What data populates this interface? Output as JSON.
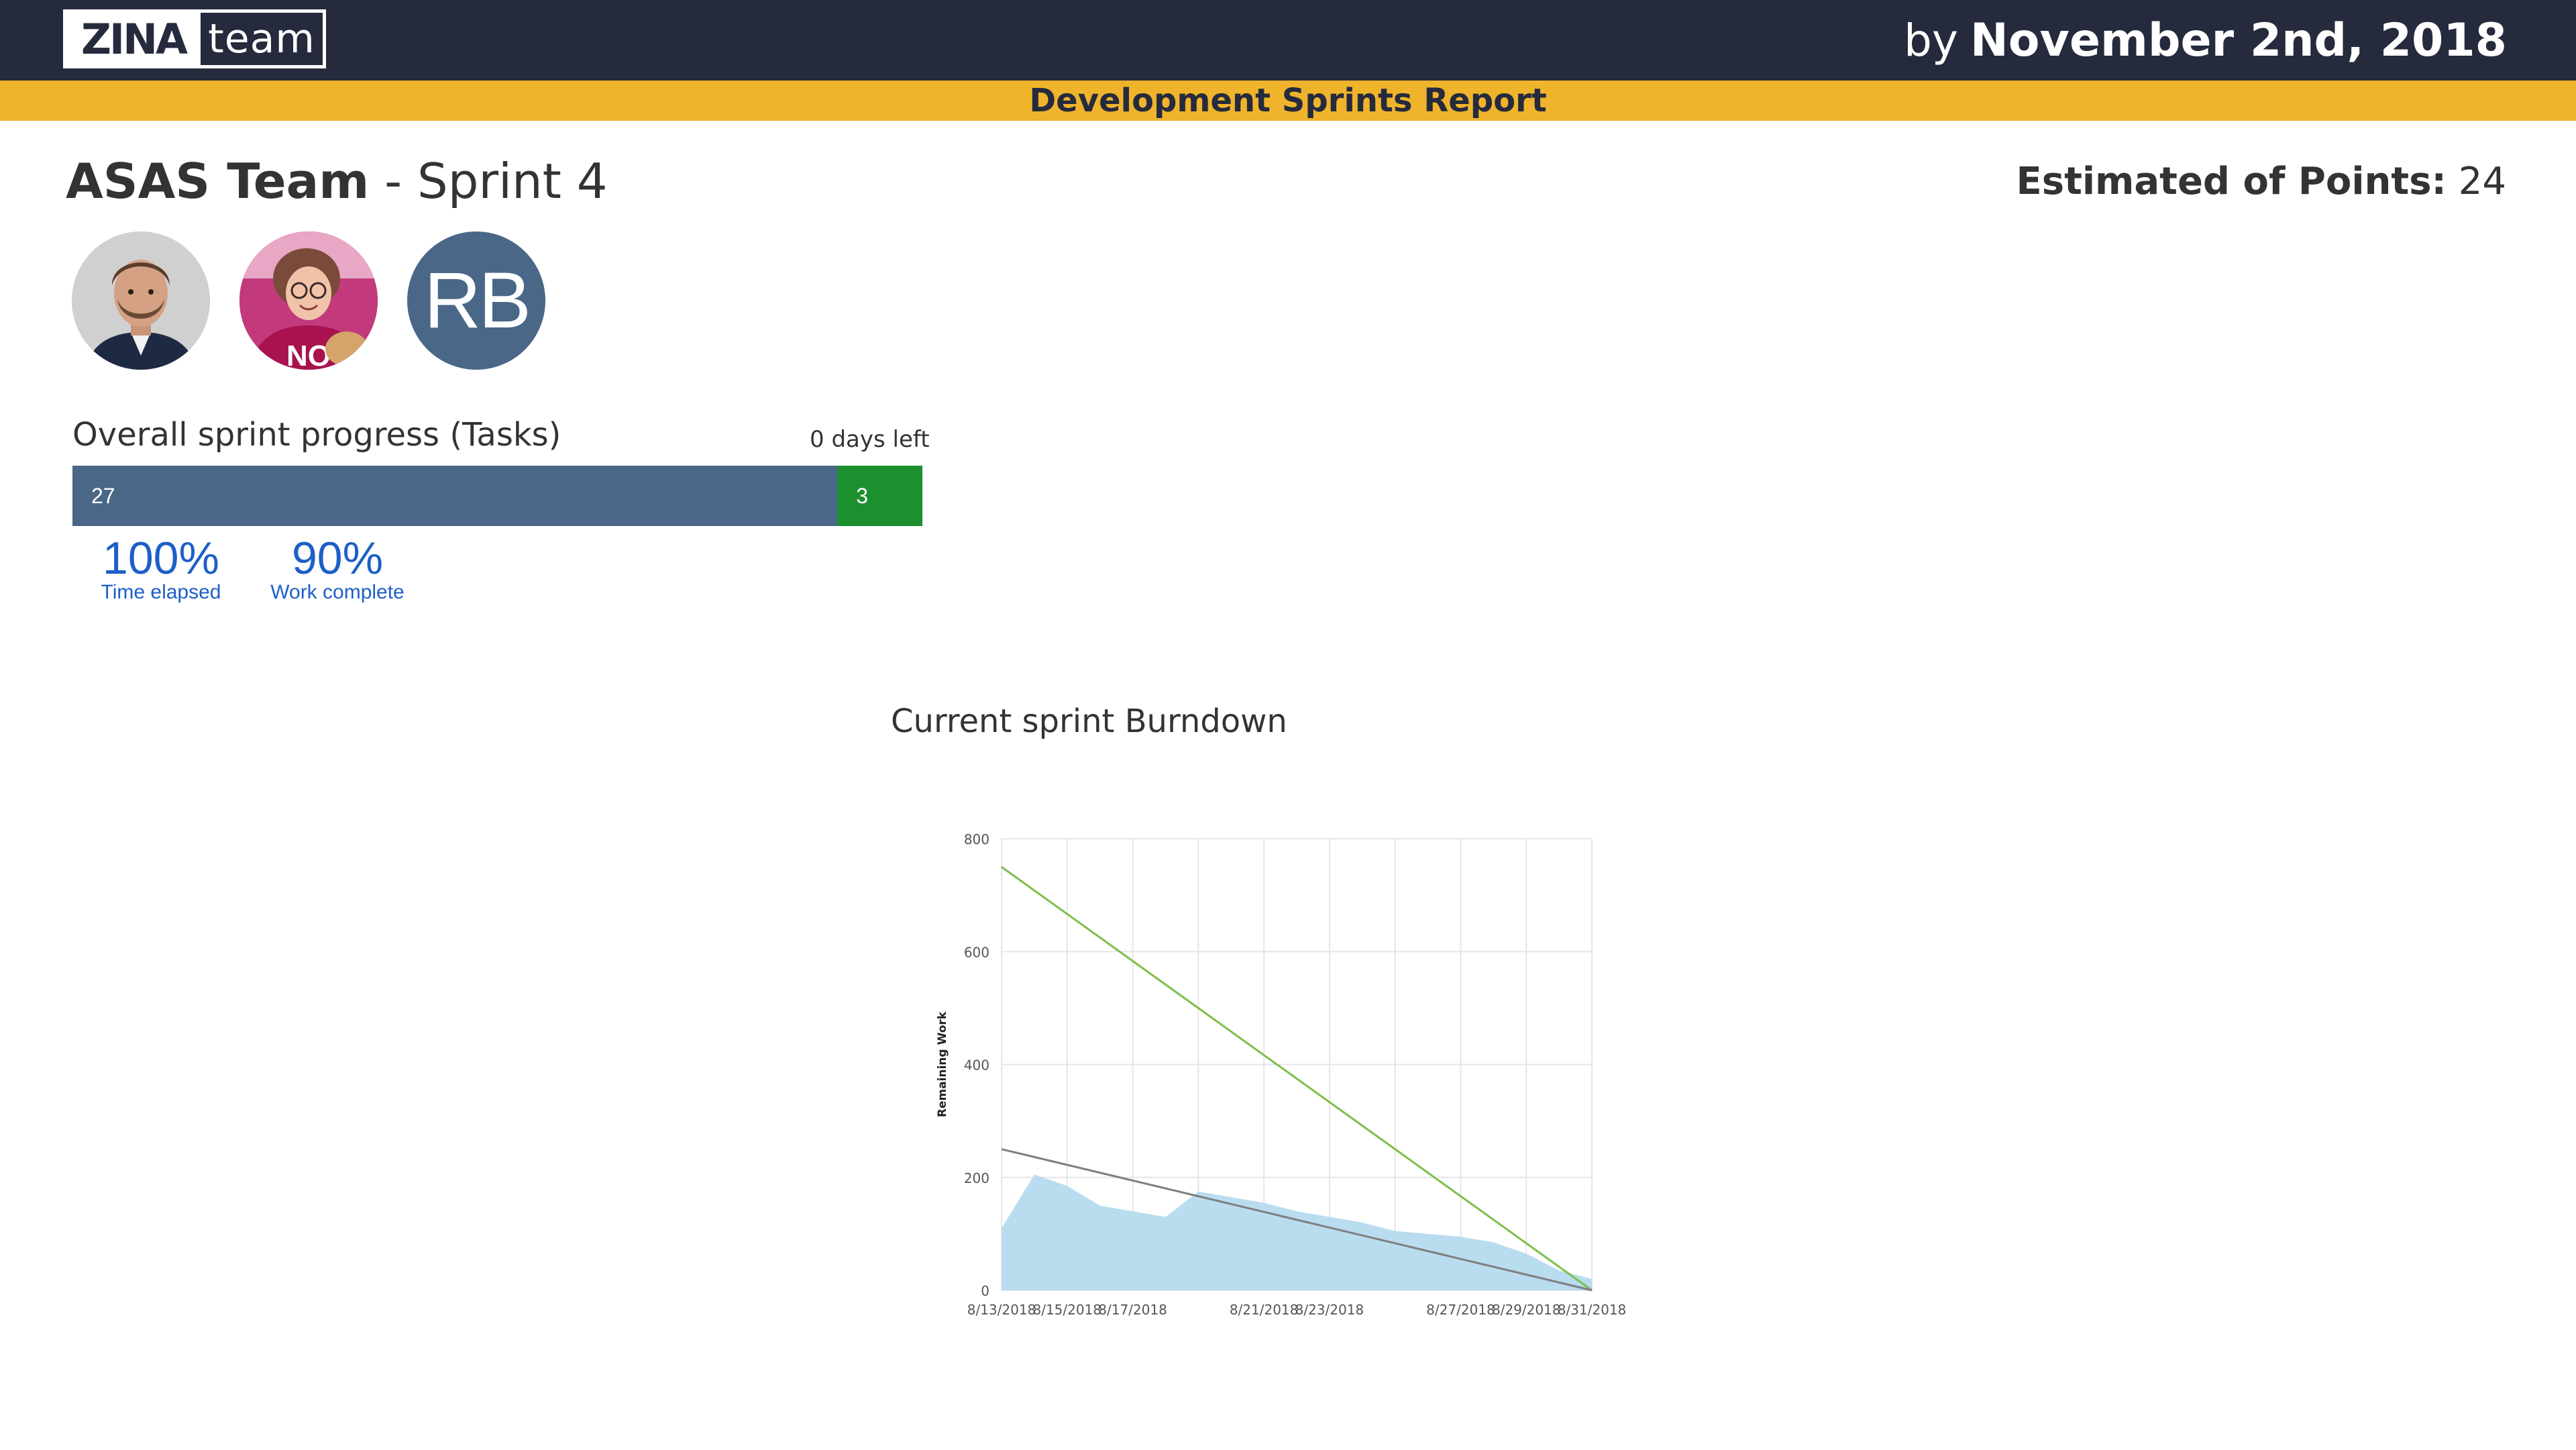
{
  "header": {
    "logo_zina": "ZINA",
    "logo_team": "team",
    "by": "by",
    "date": "November 2nd, 2018"
  },
  "banner": {
    "title": "Development Sprints Report"
  },
  "team": {
    "name": "ASAS Team",
    "separator": " - ",
    "sprint": "Sprint 4"
  },
  "estimate": {
    "label": "Estimated of Points:",
    "value": "24"
  },
  "avatars": [
    {
      "type": "photo",
      "icon": "person-photo-icon"
    },
    {
      "type": "photo",
      "icon": "person-photo-icon"
    },
    {
      "type": "initials",
      "initials": "RB",
      "color": "#4a6787"
    }
  ],
  "progress": {
    "label": "Overall sprint progress (Tasks)",
    "days_left": "0 days left",
    "done": 27,
    "remaining": 3,
    "done_color": "#4a6787",
    "remaining_color": "#1c8f2f"
  },
  "stats": [
    {
      "value": "100%",
      "label": "Time elapsed"
    },
    {
      "value": "90%",
      "label": "Work complete"
    }
  ],
  "chart_title": "Current sprint Burndown",
  "chart_data": {
    "type": "area",
    "title": "Current sprint Burndown",
    "xlabel": "",
    "ylabel": "Remaining Work",
    "ylim": [
      0,
      800
    ],
    "yticks": [
      0,
      200,
      400,
      600,
      800
    ],
    "xlim": [
      "8/13/2018",
      "8/31/2018"
    ],
    "xticks": [
      "8/13/2018",
      "8/15/2018",
      "8/17/2018",
      "8/21/2018",
      "8/23/2018",
      "8/27/2018",
      "8/29/2018",
      "8/31/2018"
    ],
    "grid": true,
    "series": [
      {
        "kind": "area",
        "color": "#b9dcef",
        "x": [
          "8/13/2018",
          "8/14/2018",
          "8/15/2018",
          "8/16/2018",
          "8/17/2018",
          "8/18/2018",
          "8/19/2018",
          "8/21/2018",
          "8/22/2018",
          "8/23/2018",
          "8/24/2018",
          "8/25/2018",
          "8/26/2018",
          "8/27/2018",
          "8/28/2018",
          "8/29/2018",
          "8/30/2018",
          "8/31/2018"
        ],
        "values": [
          110,
          205,
          185,
          150,
          140,
          130,
          175,
          155,
          140,
          130,
          120,
          105,
          100,
          95,
          85,
          65,
          35,
          20
        ]
      },
      {
        "kind": "line",
        "color": "#7cbf4a",
        "x": [
          "8/13/2018",
          "8/31/2018"
        ],
        "values": [
          750,
          0
        ]
      },
      {
        "kind": "line",
        "color": "#7f7f7f",
        "x": [
          "8/13/2018",
          "8/31/2018"
        ],
        "values": [
          250,
          0
        ]
      }
    ]
  }
}
